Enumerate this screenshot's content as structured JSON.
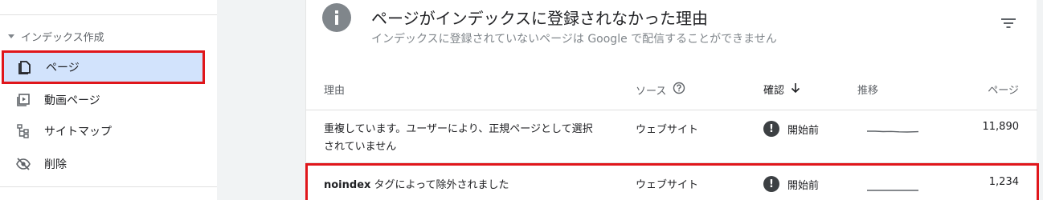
{
  "sidebar": {
    "section_label": "インデックス作成",
    "items": [
      {
        "label": "ページ",
        "icon": "page-icon",
        "active": true
      },
      {
        "label": "動画ページ",
        "icon": "video-page-icon"
      },
      {
        "label": "サイトマップ",
        "icon": "sitemap-icon"
      },
      {
        "label": "削除",
        "icon": "hidden-eye-icon"
      }
    ]
  },
  "card": {
    "title": "ページがインデックスに登録されなかった理由",
    "subtitle": "インデックスに登録されていないページは Google で配信することができません",
    "info_icon": "info-icon",
    "filter_icon": "filter-icon"
  },
  "table": {
    "headers": {
      "reason": "理由",
      "source": "ソース",
      "confirm": "確認",
      "trend": "推移",
      "pages": "ページ"
    },
    "rows": [
      {
        "reason": "重複しています。ユーザーにより、正規ページとして選択されていません",
        "source": "ウェブサイト",
        "status": "開始前",
        "count": "11,890"
      },
      {
        "reason_bold": "noindex",
        "reason_rest": " タグによって除外されました",
        "source": "ウェブサイト",
        "status": "開始前",
        "count": "1,234"
      }
    ]
  },
  "colors": {
    "highlight_border": "#e0161b",
    "active_bg": "#d2e3fc",
    "status_icon": "#3c4043"
  }
}
